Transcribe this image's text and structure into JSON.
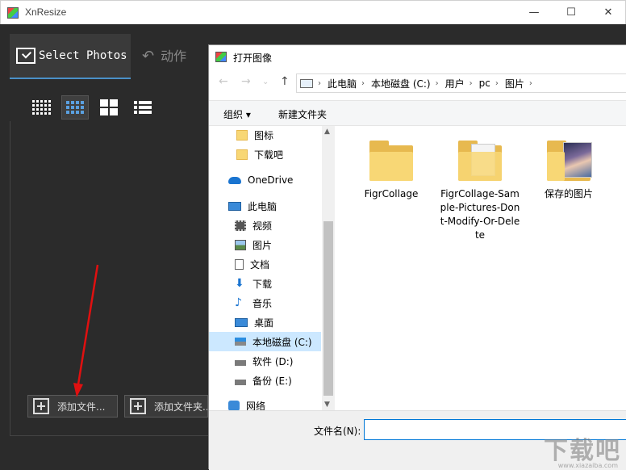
{
  "app": {
    "title": "XnResize",
    "tabs": [
      {
        "label": "Select Photos",
        "icon": "select-photos-icon"
      },
      {
        "label": "动作",
        "icon": "undo-arrow-icon"
      }
    ],
    "view_modes": [
      "small-grid-icon",
      "medium-grid-icon",
      "large-grid-icon",
      "list-icon"
    ],
    "buttons": {
      "add_files": "添加文件...",
      "add_folder": "添加文件夹..."
    }
  },
  "window_controls": {
    "minimize": "—",
    "maximize": "☐",
    "close": "✕"
  },
  "dialog": {
    "title": "打开图像",
    "address": [
      "此电脑",
      "本地磁盘 (C:)",
      "用户",
      "pc",
      "图片"
    ],
    "toolbar": {
      "organize": "组织 ▾",
      "new_folder": "新建文件夹"
    },
    "nav_items": [
      {
        "label": "图标",
        "icon": "folder-icon"
      },
      {
        "label": "下载吧",
        "icon": "folder-icon"
      },
      {
        "label": "OneDrive",
        "icon": "cloud-icon"
      },
      {
        "label": "此电脑",
        "icon": "computer-icon"
      },
      {
        "label": "视频",
        "icon": "video-icon"
      },
      {
        "label": "图片",
        "icon": "pictures-icon"
      },
      {
        "label": "文档",
        "icon": "document-icon"
      },
      {
        "label": "下载",
        "icon": "download-icon"
      },
      {
        "label": "音乐",
        "icon": "music-icon"
      },
      {
        "label": "桌面",
        "icon": "desktop-icon"
      },
      {
        "label": "本地磁盘 (C:)",
        "icon": "drive-c-icon"
      },
      {
        "label": "软件 (D:)",
        "icon": "drive-icon"
      },
      {
        "label": "备份 (E:)",
        "icon": "drive-icon"
      },
      {
        "label": "网络",
        "icon": "network-icon"
      }
    ],
    "files": [
      {
        "name": "FigrCollage",
        "type": "folder"
      },
      {
        "name": "FigrCollage-Sample-Pictures-Dont-Modify-Or-Delete",
        "type": "folder-with-document"
      },
      {
        "name": "保存的图片",
        "type": "folder-with-photo"
      }
    ],
    "filename_label": "文件名(N):",
    "filename_value": ""
  },
  "watermark": {
    "text": "下载吧",
    "url": "www.xiazaiba.com"
  }
}
